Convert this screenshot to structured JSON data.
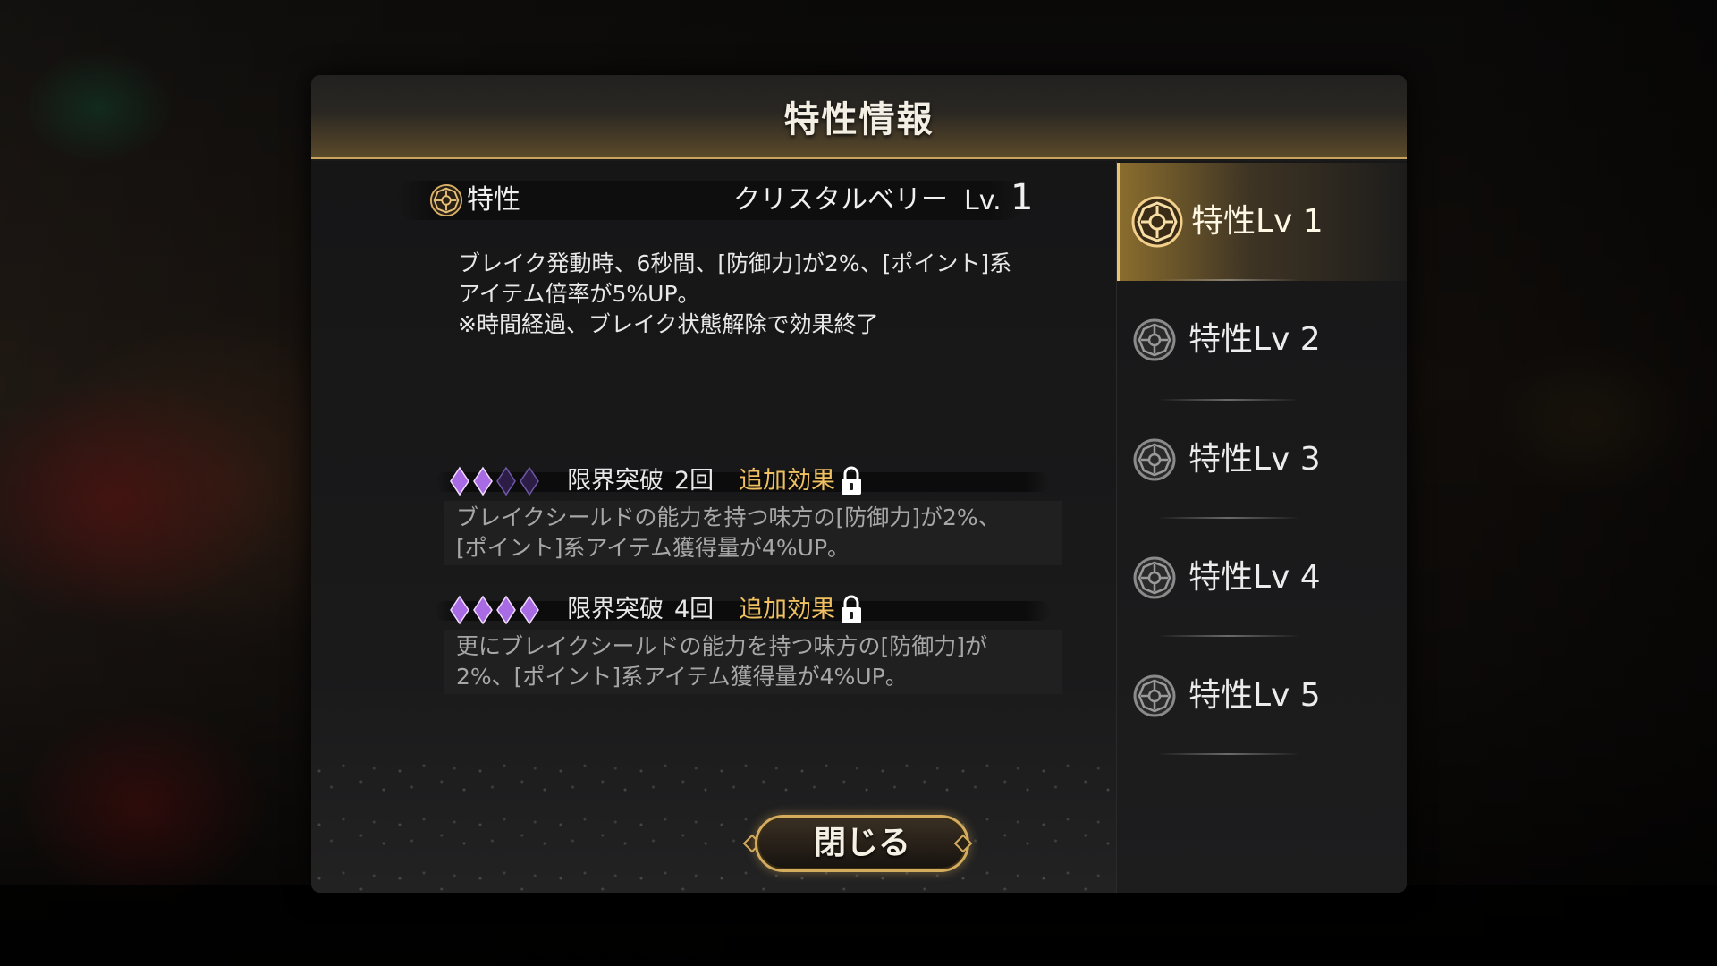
{
  "dialog": {
    "title": "特性情報"
  },
  "trait": {
    "icon": "trait-emblem-icon",
    "label": "特性",
    "name": "クリスタルベリー",
    "level_prefix": "Lv.",
    "level": "1",
    "description_lines": [
      "ブレイク発動時、6秒間、[防御力]が2%、[ポイント]系",
      "アイテム倍率が5%UP。",
      "※時間経過、ブレイク状態解除で効果終了"
    ]
  },
  "limit_breaks": [
    {
      "gems_filled": 2,
      "gems_total": 4,
      "label": "限界突破",
      "count": "2回",
      "extra_label": "追加効果",
      "locked": true,
      "description_lines": [
        "ブレイクシールドの能力を持つ味方の[防御力]が2%、",
        "[ポイント]系アイテム獲得量が4%UP。"
      ]
    },
    {
      "gems_filled": 4,
      "gems_total": 4,
      "label": "限界突破",
      "count": "4回",
      "extra_label": "追加効果",
      "locked": true,
      "description_lines": [
        "更にブレイクシールドの能力を持つ味方の[防御力]が",
        "2%、[ポイント]系アイテム獲得量が4%UP。"
      ]
    }
  ],
  "tabs": [
    {
      "label": "特性Lv 1",
      "active": true
    },
    {
      "label": "特性Lv 2",
      "active": false
    },
    {
      "label": "特性Lv 3",
      "active": false
    },
    {
      "label": "特性Lv 4",
      "active": false
    },
    {
      "label": "特性Lv 5",
      "active": false
    }
  ],
  "close_button": {
    "label": "閉じる"
  },
  "colors": {
    "accent_gold": "#d4ac5e",
    "extra_effect": "#f0c061",
    "gem_purple": "#9b4fd8"
  }
}
